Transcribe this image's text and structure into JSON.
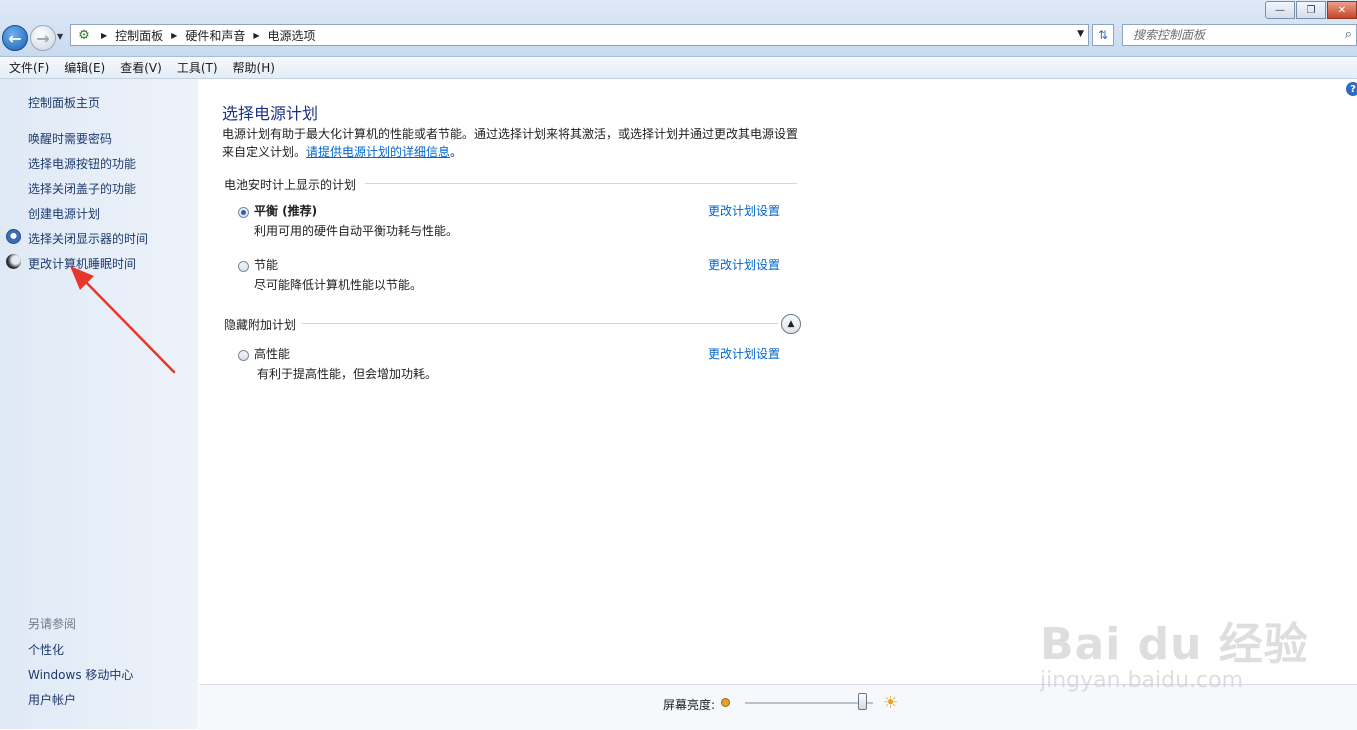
{
  "window": {
    "minimize_label": "—",
    "maximize_label": "❐",
    "close_label": "✕"
  },
  "addressbar": {
    "breadcrumbs": [
      "控制面板",
      "硬件和声音",
      "电源选项"
    ],
    "search_placeholder": "搜索控制面板"
  },
  "menu": [
    "文件(F)",
    "编辑(E)",
    "查看(V)",
    "工具(T)",
    "帮助(H)"
  ],
  "sidebar": {
    "home": "控制面板主页",
    "links": [
      "唤醒时需要密码",
      "选择电源按钮的功能",
      "选择关闭盖子的功能",
      "创建电源计划",
      "选择关闭显示器的时间",
      "更改计算机睡眠时间"
    ],
    "see_also_title": "另请参阅",
    "see_also": [
      "个性化",
      "Windows 移动中心",
      "用户帐户"
    ]
  },
  "main": {
    "title": "选择电源计划",
    "description": "电源计划有助于最大化计算机的性能或者节能。通过选择计划来将其激活，或选择计划并通过更改其电源设置来自定义计划。",
    "description_link": "请提供电源计划的详细信息",
    "description_end": "。",
    "battery_section": "电池安时计上显示的计划",
    "hidden_section": "隐藏附加计划",
    "plans": [
      {
        "name": "平衡 (推荐)",
        "desc": "利用可用的硬件自动平衡功耗与性能。",
        "link": "更改计划设置",
        "selected": true
      },
      {
        "name": "节能",
        "desc": "尽可能降低计算机性能以节能。",
        "link": "更改计划设置",
        "selected": false
      },
      {
        "name": "高性能",
        "desc": "有利于提高性能，但会增加功耗。",
        "link": "更改计划设置",
        "selected": false
      }
    ]
  },
  "brightness": {
    "label": "屏幕亮度:",
    "level": 0.95
  },
  "watermark": {
    "main": "Bai du 经验",
    "sub": "jingyan.baidu.com"
  },
  "colors": {
    "accent_link": "#0066cc",
    "title_blue": "#1e3287",
    "annotation_red": "#e8362b"
  }
}
